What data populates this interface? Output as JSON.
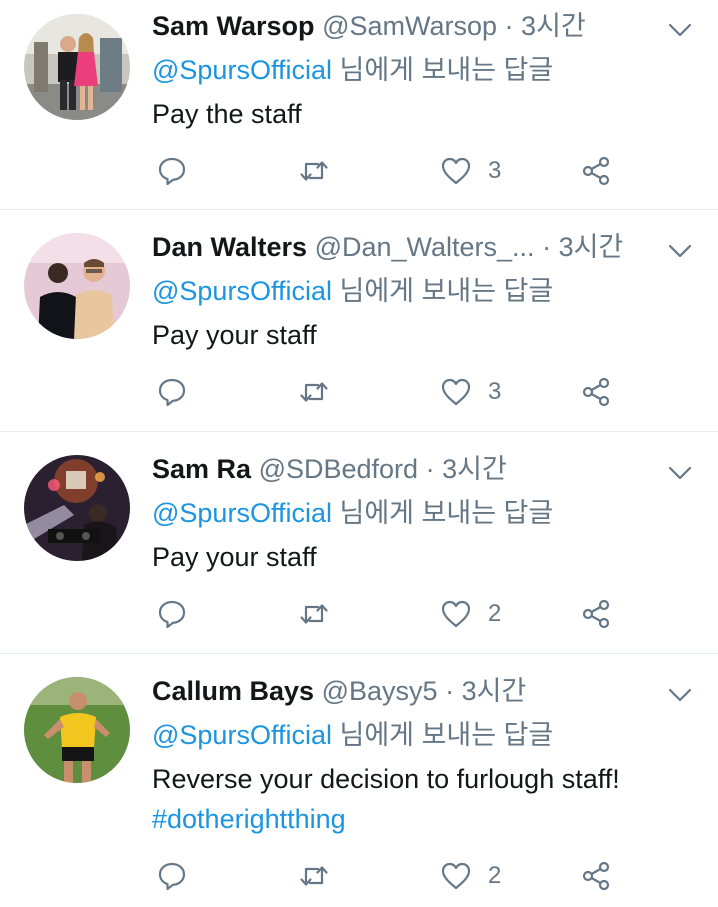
{
  "reply_to_label": "님에게 보내는 답글",
  "tweets": [
    {
      "name": "Sam Warsop",
      "handle": "@SamWarsop",
      "separator": "·",
      "time": "3시간",
      "reply_to": "@SpursOfficial",
      "text": "Pay the staff",
      "hashtag": "",
      "like_count": "3",
      "avatar_icon": "avatar-couple-photo"
    },
    {
      "name": "Dan Walters",
      "handle": "@Dan_Walters_...",
      "separator": "·",
      "time": "3시간",
      "reply_to": "@SpursOfficial",
      "text": "Pay your staff",
      "hashtag": "",
      "like_count": "3",
      "avatar_icon": "avatar-two-men-photo"
    },
    {
      "name": "Sam Ra",
      "handle": "@SDBedford",
      "separator": "·",
      "time": "3시간",
      "reply_to": "@SpursOfficial",
      "text": "Pay your staff",
      "hashtag": "",
      "like_count": "2",
      "avatar_icon": "avatar-dj-photo"
    },
    {
      "name": "Callum Bays",
      "handle": "@Baysy5",
      "separator": "·",
      "time": "3시간",
      "reply_to": "@SpursOfficial",
      "text": "Reverse your decision to furlough staff!",
      "hashtag": "#dotherightthing",
      "like_count": "2",
      "avatar_icon": "avatar-footballer-photo"
    }
  ],
  "colors": {
    "link": "#1b95e0",
    "secondary_text": "#657786",
    "icon": "#657786",
    "divider": "#e6ecf0"
  }
}
